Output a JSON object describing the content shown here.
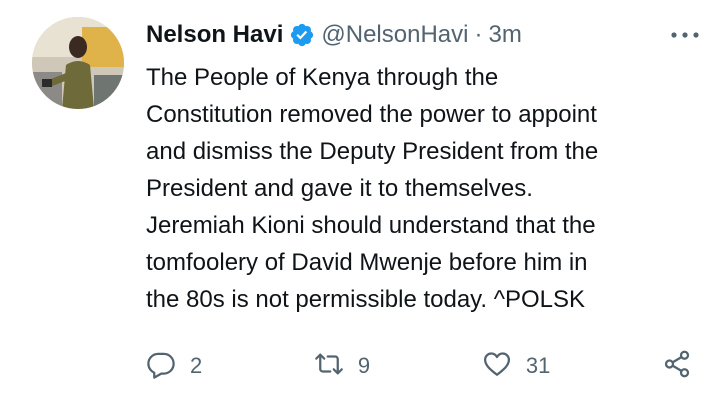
{
  "author": {
    "name": "Nelson Havi",
    "handle": "@NelsonHavi",
    "separator": "·",
    "time": "3m"
  },
  "tweet": {
    "text": "The People of Kenya through the\nConstitution removed the power to appoint\nand dismiss the Deputy President from the\nPresident and gave it to themselves.\nJeremiah Kioni should understand that the\ntomfoolery of David Mwenje before him in\nthe 80s is not permissible today. ^POLSK"
  },
  "actions": {
    "reply_count": "2",
    "retweet_count": "9",
    "like_count": "31"
  },
  "icons": {
    "verified": "verified-badge-icon",
    "more": "more-options-icon",
    "reply": "reply-icon",
    "retweet": "retweet-icon",
    "like": "heart-icon",
    "share": "share-icon"
  },
  "colors": {
    "verified_blue": "#1d9bf0",
    "text_primary": "#0f1419",
    "text_secondary": "#536471"
  }
}
